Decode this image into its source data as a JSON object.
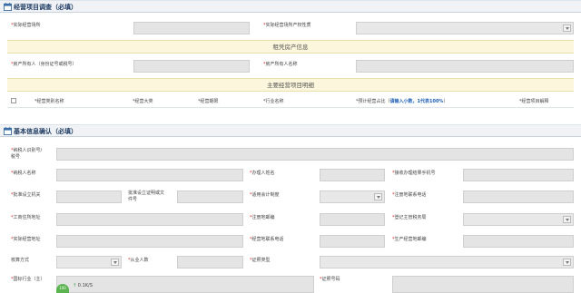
{
  "section1": {
    "title": "经营项目调查（必填）",
    "actual_address_label": "*实际经营场所",
    "property_nature_label": "*实际经营场所产权性质",
    "rental_banner": "租凭房产信息",
    "owner_id_label": "*房产所有人（身份证号或税号）",
    "owner_name_label": "*房产所有人名称",
    "items_banner": "主要经营项目明细",
    "columns": {
      "category_name": "*经营类别名称",
      "category": "*经营大类",
      "period": "*经营期限",
      "industry": "*行业名称",
      "ratio_prefix": "*预计经营占比（",
      "ratio_hint": "请输入小数，1代表100%",
      "ratio_suffix": "）",
      "explain": "*经营项目解释"
    }
  },
  "section2": {
    "title": "基本信息确认（必填）",
    "taxpayer_id_label": "*纳税人识别号/\n税号",
    "taxpayer_name_label": "*纳税人名称",
    "handler_name_label": "*办理人姓名",
    "handler_phone_label": "*接收办理结果手机号",
    "approval_org_label": "*批准设立机关",
    "approval_doc_label": "批准设立证明或文\n件号",
    "accounting_label": "*适用会计制度",
    "reg_phone_label": "*注册地联系电话",
    "business_address_label": "*工商住所地址",
    "reg_postcode_label": "*注册地邮编",
    "reg_authority_label": "*登记主管税务局",
    "actual_address_label": "*实际经营地址",
    "biz_phone_label": "*经营地联系电话",
    "prod_postcode_label": "*生产经营地邮编",
    "accounting_method_label": "核算方式",
    "employees_label": "*从业人数",
    "cert_type_label": "*证照类型",
    "national_industry_label": "*国标行业（主）",
    "cert_number_label": "*证照号码"
  },
  "status": {
    "badge": "100",
    "speed": "0.1K/S",
    "arrow": "↑"
  },
  "colors": {
    "header_text": "#1e3c64",
    "required": "#e02020",
    "hint": "#1f5fb5",
    "banner_bg": "#fcf7dc",
    "field_bg": "#e4e4e4"
  }
}
